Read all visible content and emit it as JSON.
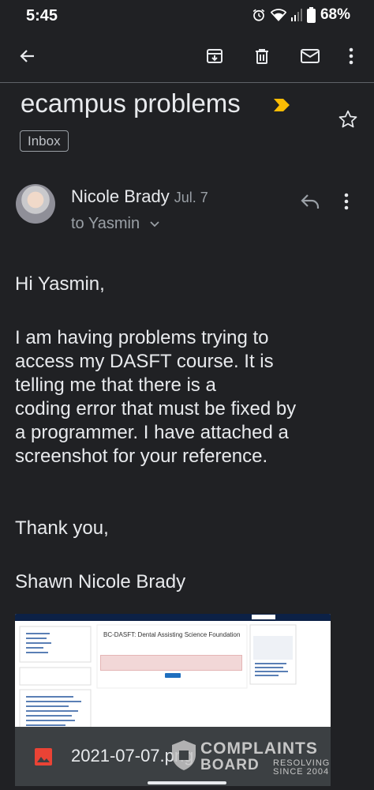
{
  "status_bar": {
    "time": "5:45",
    "battery": "68%"
  },
  "toolbar": {
    "back_icon": "arrow-back-icon",
    "archive_icon": "archive-icon",
    "delete_icon": "trash-icon",
    "mail_icon": "mark-unread-icon",
    "more_icon": "more-vert-icon"
  },
  "email": {
    "subject": "ecampus problems",
    "label": "Inbox",
    "sender_name": "Nicole Brady",
    "date": "Jul. 7",
    "recipient": "to Yasmin",
    "body": {
      "greeting": "Hi Yasmin,",
      "paragraph_lines": [
        "I am having problems trying to",
        "access my DASFT course. It is",
        "telling me that there is a",
        "coding error that must be fixed by",
        "a programmer. I have attached a",
        "screenshot for your reference."
      ],
      "closing": "Thank you,",
      "signature": "Shawn Nicole Brady"
    },
    "attachment": {
      "filename": "2021-07-07.png",
      "preview_title": "BC-DASFT: Dental Assisting Science Foundation"
    }
  },
  "watermark": {
    "line1": "COMPLAINTS",
    "line2": "BOARD",
    "tag1": "RESOLVING",
    "tag2": "SINCE 2004"
  },
  "colors": {
    "background": "#202124",
    "importance_marker": "#fbbc04",
    "attachment_icon": "#ea4335"
  }
}
